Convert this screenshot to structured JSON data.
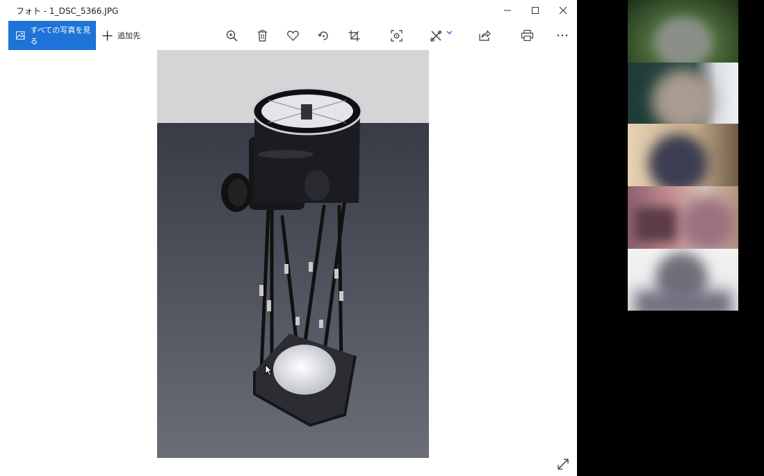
{
  "window": {
    "title": "フォト - 1_DSC_5366.JPG",
    "controls": [
      "minimize-icon",
      "maximize-icon",
      "close-icon"
    ]
  },
  "toolbar": {
    "all_photos_label": "すべての写真を見る",
    "add_label": "追加先",
    "tools": [
      "zoom-in-icon",
      "delete-icon",
      "favorite-icon",
      "rotate-icon",
      "crop-icon",
      "enhance-icon",
      "edit-draw-icon",
      "share-icon",
      "print-icon",
      "more-icon"
    ]
  },
  "colors": {
    "accent": "#1e73d8",
    "window_bg": "#ffffff",
    "desktop_bg": "#000000"
  },
  "participants": {
    "count": 5
  }
}
